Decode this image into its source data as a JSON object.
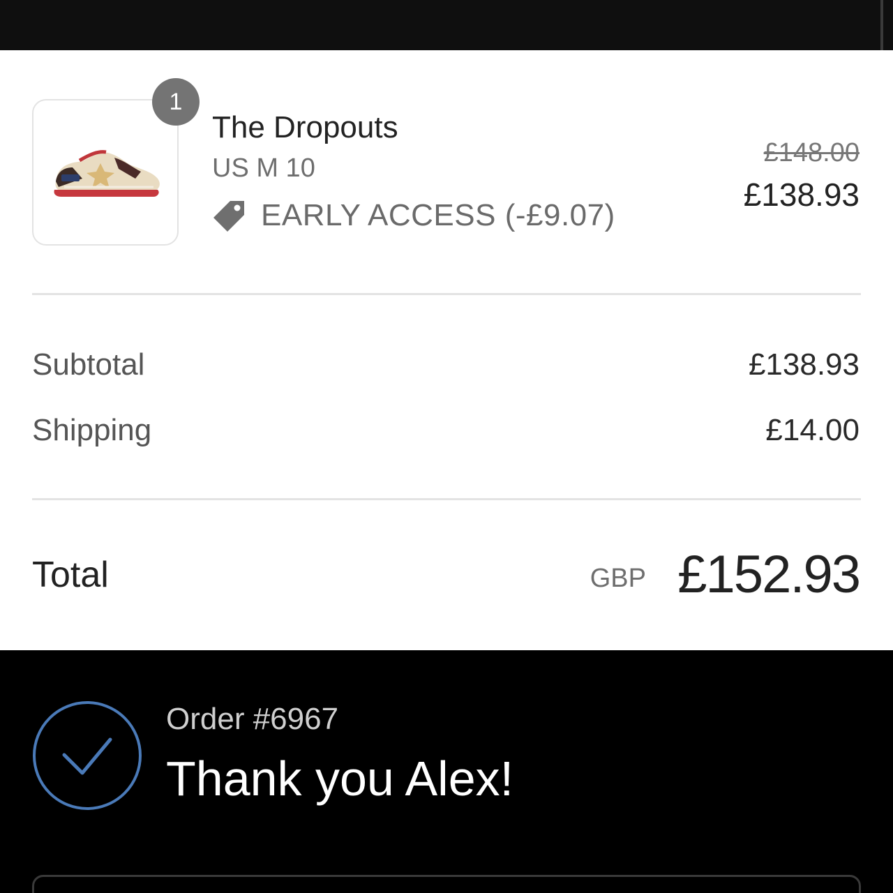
{
  "order_item": {
    "quantity": "1",
    "title": "The Dropouts",
    "variant": "US M 10",
    "discount_label": "EARLY ACCESS (-£9.07)",
    "original_price": "£148.00",
    "price": "£138.93",
    "image_icon": "sneaker-image"
  },
  "totals": {
    "subtotal_label": "Subtotal",
    "subtotal_value": "£138.93",
    "shipping_label": "Shipping",
    "shipping_value": "£14.00",
    "total_label": "Total",
    "currency": "GBP",
    "total_value": "£152.93"
  },
  "confirmation": {
    "order_number": "Order #6967",
    "thank_you": "Thank you Alex!",
    "icon": "check-circle-icon"
  },
  "colors": {
    "accent_blue": "#4a7ab8",
    "background_dark": "#000000",
    "badge_gray": "#747474"
  }
}
